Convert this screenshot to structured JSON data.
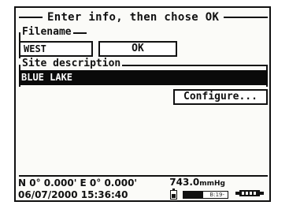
{
  "dialog": {
    "title": "Enter info, then chose OK"
  },
  "filename": {
    "label": "Filename",
    "value": "WEST",
    "ok_label": "OK"
  },
  "site": {
    "label": "Site description",
    "value": "BLUE LAKE",
    "configure_label": "Configure..."
  },
  "status": {
    "gps": "N 0° 0.000' E 0° 0.000'",
    "datetime": "06/07/2000 15:36:40",
    "pressure_value": "743.0",
    "pressure_unit": "mmHg",
    "memory_label": "B:19-",
    "memory_fill_fraction": 0.45
  },
  "icons": {
    "battery": "battery-icon",
    "device": "device-icon"
  },
  "colors": {
    "screen_bg": "#fbfbf8",
    "ink": "#111111",
    "highlight_bg": "#0a0a0a",
    "highlight_text": "#ffffff"
  }
}
